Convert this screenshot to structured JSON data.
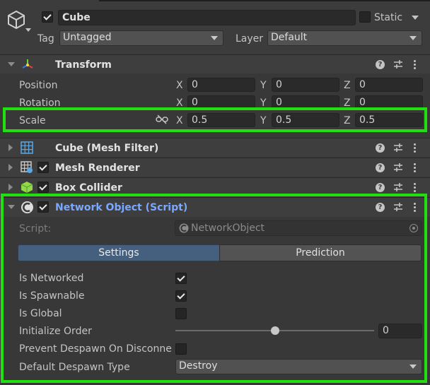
{
  "gameobject": {
    "icon": "cube-outline-icon",
    "active": true,
    "name": "Cube",
    "static_label": "Static",
    "static": false,
    "tag_label": "Tag",
    "tag_value": "Untagged",
    "layer_label": "Layer",
    "layer_value": "Default"
  },
  "transform": {
    "title": "Transform",
    "icon": "transform-axes-icon",
    "expanded": true,
    "rows": [
      {
        "label": "Position",
        "x": "0",
        "y": "0",
        "z": "0"
      },
      {
        "label": "Rotation",
        "x": "0",
        "y": "0",
        "z": "0"
      },
      {
        "label": "Scale",
        "x": "0.5",
        "y": "0.5",
        "z": "0.5",
        "constrain_icon": "unlinked-proportions-icon"
      }
    ],
    "axis_labels": {
      "x": "X",
      "y": "Y",
      "z": "Z"
    }
  },
  "components": [
    {
      "title": "Cube (Mesh Filter)",
      "icon": "mesh-grid-icon",
      "has_checkbox": false
    },
    {
      "title": "Mesh Renderer",
      "icon": "mesh-renderer-icon",
      "has_checkbox": true,
      "enabled": true
    },
    {
      "title": "Box Collider",
      "icon": "green-cube-icon",
      "has_checkbox": true,
      "enabled": true
    }
  ],
  "network_object": {
    "title": "Network Object (Script)",
    "enabled": true,
    "icon": "network-script-icon",
    "title_color": "#7aa8ff",
    "script_label": "Script:",
    "script_value": "NetworkObject",
    "tabs": [
      {
        "label": "Settings",
        "active": true
      },
      {
        "label": "Prediction",
        "active": false
      }
    ],
    "fields": {
      "is_networked": {
        "label": "Is Networked",
        "checked": true
      },
      "is_spawnable": {
        "label": "Is Spawnable",
        "checked": true
      },
      "is_global": {
        "label": "Is Global",
        "checked": false
      },
      "initialize_order": {
        "label": "Initialize Order",
        "value": "0",
        "slider_fraction": 0.5
      },
      "prevent_despawn": {
        "label": "Prevent Despawn On Disconne",
        "checked": false
      },
      "default_despawn_type": {
        "label": "Default Despawn Type",
        "value": "Destroy"
      }
    }
  },
  "highlight_color": "#22e010"
}
